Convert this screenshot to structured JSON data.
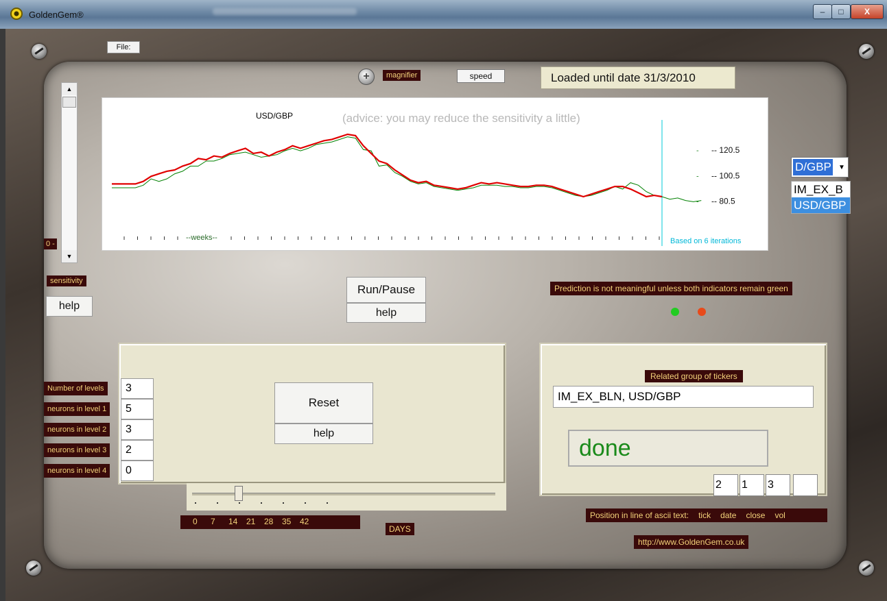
{
  "window": {
    "title": "GoldenGem®",
    "controls": {
      "minimize": "–",
      "maximize": "□",
      "close": "X"
    }
  },
  "menu": {
    "file": "File:"
  },
  "toolbar": {
    "magnifier_label": "magnifier",
    "speed_label": "speed",
    "loaded_status": "Loaded until date 31/3/2010"
  },
  "chart_data": {
    "type": "line",
    "title": "USD/GBP",
    "advice": "(advice: you may reduce the sensitivity a little)",
    "x_axis_label": "--weeks--",
    "y_ticks": [
      "120.5",
      "100.5",
      "80.5"
    ],
    "ylim": [
      70,
      140
    ],
    "footnote": "Based on  6 iterations",
    "series": [
      {
        "color": "#e00000",
        "values": [
          94,
          94,
          94,
          94,
          96,
          100,
          102,
          104,
          105,
          108,
          110,
          114,
          113,
          116,
          115,
          118,
          120,
          122,
          118,
          119,
          116,
          119,
          121,
          124,
          122,
          124,
          126,
          128,
          129,
          131,
          133,
          132,
          124,
          118,
          112,
          110,
          105,
          101,
          97,
          95,
          96,
          93,
          92,
          91,
          90,
          91,
          93,
          95,
          94,
          95,
          94,
          93,
          92,
          92,
          93,
          93,
          92,
          90,
          88,
          86,
          84,
          86,
          88,
          90,
          92,
          92,
          90,
          87,
          84,
          85,
          84
        ]
      },
      {
        "color": "#008000",
        "values": [
          91,
          91,
          91,
          91,
          93,
          98,
          96,
          98,
          102,
          104,
          108,
          108,
          112,
          112,
          114,
          117,
          118,
          119,
          117,
          115,
          116,
          117,
          120,
          122,
          120,
          122,
          125,
          126,
          127,
          129,
          131,
          130,
          121,
          120,
          108,
          109,
          103,
          100,
          96,
          94,
          95,
          92,
          91,
          90,
          89,
          90,
          91,
          93,
          93,
          93,
          92,
          92,
          91,
          91,
          92,
          92,
          91,
          89,
          87,
          85,
          84,
          85,
          87,
          89,
          92,
          90,
          95,
          93,
          88,
          85,
          84,
          82,
          83,
          81,
          80,
          81
        ]
      }
    ]
  },
  "sensitivity": {
    "zero_label": "0 -",
    "label": "sensitivity",
    "help": "help",
    "level": 0.1
  },
  "run": {
    "run_pause": "Run/Pause",
    "help": "help"
  },
  "prediction_note": "Prediction is not meaningful unless both indicators remain green",
  "indicators": {
    "left_color": "#22cc22",
    "right_color": "#e84a1a"
  },
  "ticker_dropdown": {
    "selected": "D/GBP",
    "options": [
      "IM_EX_B",
      "USD/GBP"
    ]
  },
  "network": {
    "fields": [
      {
        "label": "Number of levels",
        "value": "3"
      },
      {
        "label": "neurons in level 1",
        "value": "5"
      },
      {
        "label": "neurons in level 2",
        "value": "3"
      },
      {
        "label": "neurons in level 3",
        "value": "2"
      },
      {
        "label": "neurons in level 4",
        "value": "0"
      }
    ],
    "reset": "Reset",
    "help": "help"
  },
  "days": {
    "ticks": [
      "0",
      "7",
      "14",
      "21",
      "28",
      "35",
      "42"
    ],
    "label": "DAYS",
    "value": 14
  },
  "related": {
    "label": "Related group of tickers",
    "value": "IM_EX_BLN, USD/GBP",
    "status": "done",
    "positions": [
      "2",
      "1",
      "3",
      ""
    ],
    "position_label": "Position in line of ascii text:",
    "position_cols": [
      "tick",
      "date",
      "close",
      "vol"
    ],
    "url": "http://www.GoldenGem.co.uk"
  }
}
